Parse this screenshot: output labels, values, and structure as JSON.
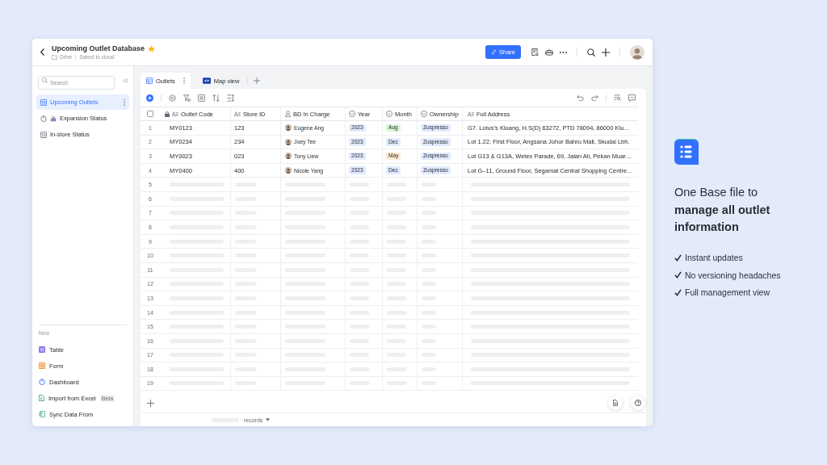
{
  "header": {
    "title": "Upcoming Outlet Database",
    "starred": true,
    "location": "Drive",
    "save_status": "Saved to cloud",
    "share_label": "Share"
  },
  "sidebar": {
    "search": {
      "placeholder": "Search"
    },
    "items": [
      {
        "kind": "table",
        "label": "Upcoming Outlets",
        "selected": true
      },
      {
        "kind": "dashboard",
        "label": "Expansion Status",
        "selected": false
      },
      {
        "kind": "table",
        "label": "In-store Status",
        "selected": false
      }
    ],
    "new_section": {
      "title": "New",
      "items": [
        {
          "kind": "table",
          "label": "Table"
        },
        {
          "kind": "form",
          "label": "Form"
        },
        {
          "kind": "dashboard",
          "label": "Dashboard"
        },
        {
          "kind": "excel",
          "label": "Import from Excel",
          "badge": "Beta"
        },
        {
          "kind": "sync",
          "label": "Sync Data From"
        }
      ]
    }
  },
  "view_tabs": [
    {
      "kind": "grid",
      "label": "Outlets",
      "selected": true
    },
    {
      "kind": "map",
      "label": "Map view",
      "selected": false
    }
  ],
  "table": {
    "select_all": {
      "checked": false
    },
    "columns": [
      {
        "kind": "text",
        "label": "Outlet Code",
        "locked": true
      },
      {
        "kind": "text",
        "label": "Store ID",
        "locked": false
      },
      {
        "kind": "person",
        "label": "BD In Charge",
        "locked": false
      },
      {
        "kind": "select",
        "label": "Year",
        "locked": false
      },
      {
        "kind": "select",
        "label": "Month",
        "locked": false
      },
      {
        "kind": "select",
        "label": "Ownership",
        "locked": false
      },
      {
        "kind": "text",
        "label": "Full Address",
        "locked": false
      }
    ],
    "rows": [
      {
        "number": "1",
        "outlet_code": "MY0123",
        "store_id": "123",
        "bd_in_charge": "Eugene Ang",
        "year": "2023",
        "month": {
          "label": "Aug",
          "color": "#d9f5d6"
        },
        "ownership": "Zuspresso",
        "full_address": "G7. Lotus’s Kluang, H.S(D) 63272, PTD 78094, 86000 Klu…"
      },
      {
        "number": "2",
        "outlet_code": "MY0234",
        "store_id": "234",
        "bd_in_charge": "Joey Tee",
        "year": "2023",
        "month": {
          "label": "Dec",
          "color": "#e1eaff"
        },
        "ownership": "Zuspresso",
        "full_address": "Lot 1.22, First Floor, Angsana Johor Bahru Mall, Skudai Lbh."
      },
      {
        "number": "3",
        "outlet_code": "MY0023",
        "store_id": "023",
        "bd_in_charge": "Tony Liew",
        "year": "2023",
        "month": {
          "label": "May",
          "color": "#feead2"
        },
        "ownership": "Zuspresso",
        "full_address": "Lot G13 & G13A, Wetex Parade, 69, Jalan Ali, Pekan Muar…"
      },
      {
        "number": "4",
        "outlet_code": "MY0400",
        "store_id": "400",
        "bd_in_charge": "Nicole Yang",
        "year": "2023",
        "month": {
          "label": "Dec",
          "color": "#e1eaff"
        },
        "ownership": "Zuspresso",
        "full_address": "Lot G–11, Ground Floor, Segamat Central Shopping Centre…"
      }
    ],
    "loading_rows": [
      "5",
      "6",
      "7",
      "8",
      "9",
      "10",
      "11",
      "12",
      "13",
      "14",
      "15",
      "16",
      "17",
      "18",
      "19"
    ],
    "footer": {
      "records_label": "records"
    }
  },
  "promo": {
    "heading": "One Base file to **manage all outlet information**",
    "points": [
      "Instant updates",
      "No versioning headaches",
      "Full management view"
    ]
  }
}
